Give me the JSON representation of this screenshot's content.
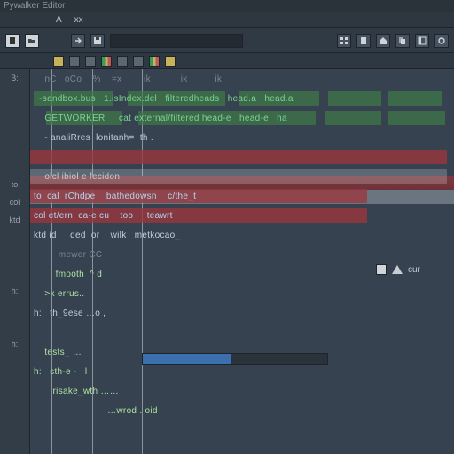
{
  "colors": {
    "bg": "#364250",
    "accent_green": "#79d48e",
    "accent_red": "#9b363c",
    "accent_blue": "#3b6fae"
  },
  "titlebar": {
    "text": "Pywalker Editor"
  },
  "menubar": {
    "items": [
      "A",
      "xx"
    ]
  },
  "toolbar": {
    "search_placeholder": "",
    "icons": [
      "file-icon",
      "folder-icon",
      "arrow-icon",
      "save-icon"
    ],
    "right_icons": [
      "grid-icon",
      "doc-icon",
      "home-icon",
      "copy-icon",
      "panel-icon",
      "tool-icon"
    ]
  },
  "subtoolbar": {
    "items": [
      "swatch-yellow",
      "swatch-gray",
      "swatch-gray",
      "swatch-multi",
      "swatch-gray",
      "swatch-gray",
      "swatch-multi",
      "swatch-yellow"
    ]
  },
  "gutter": {
    "labels": [
      "B:",
      "",
      "",
      "",
      "",
      "",
      "to",
      "col",
      "ktd",
      "",
      "",
      "",
      "h:",
      "",
      "",
      "h:"
    ]
  },
  "palette": {
    "label": "cur"
  },
  "code": {
    "lines": [
      {
        "kind": "header",
        "text": "    nC   oCo    %    =x        ik           ik          ik"
      },
      {
        "kind": "row-green",
        "text": "  -sandbox.bus   1.isIndex.del   filteredheads   head.a   head.a"
      },
      {
        "kind": "row-green",
        "text": "    GETWORKER     cat external/filtered head-e   head-e   ha"
      },
      {
        "kind": "plain",
        "text": "    - analiRres  lonitanh=  th ."
      },
      {
        "kind": "row-red-band"
      },
      {
        "kind": "plain",
        "text": "    olcl ibiol e fecidon"
      },
      {
        "kind": "row-red",
        "text": "to  cal  rChdpe    bathedowsn    c/the_t"
      },
      {
        "kind": "row-red",
        "text": "col et/ern  ca-e cu    too     teawrt"
      },
      {
        "kind": "plain",
        "text": "ktd id     ded  or    wilk   metkocao_"
      },
      {
        "kind": "plain",
        "text": "         mewer CC"
      },
      {
        "kind": "plain-green",
        "text": "        fmooth  ^ d"
      },
      {
        "kind": "plain-green",
        "text": "    >k errus.."
      },
      {
        "kind": "plain",
        "text": "h:   th_9ese …o ,"
      },
      {
        "kind": "progress-row"
      },
      {
        "kind": "plain-green",
        "text": "    tests_ …"
      },
      {
        "kind": "plain-green",
        "text": "h:   sth-e -   l"
      },
      {
        "kind": "plain-green",
        "text": "       risake_wth ……"
      },
      {
        "kind": "plain-green",
        "text": "                           …wrod . oid"
      }
    ]
  },
  "progress": {
    "percent": 48
  }
}
